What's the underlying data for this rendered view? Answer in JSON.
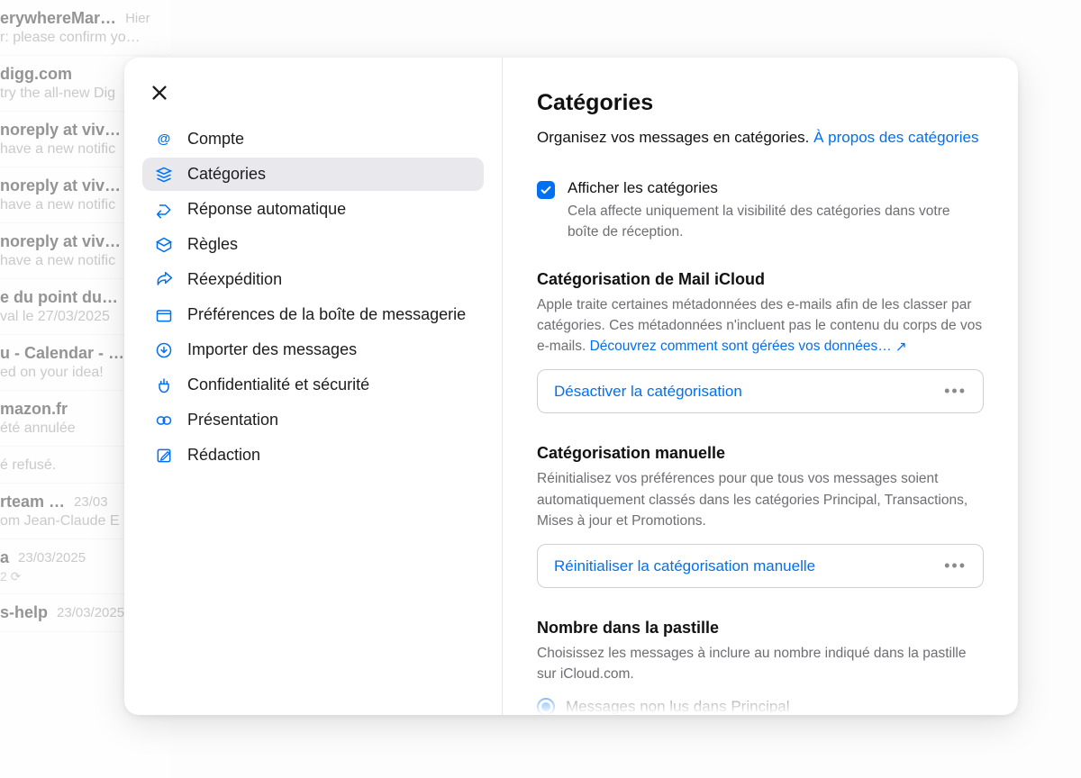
{
  "background_emails": [
    {
      "sender": "erywhereMar…",
      "date": "Hier",
      "preview": "r: please confirm yo…",
      "dot": true
    },
    {
      "sender": "digg.com",
      "date": "",
      "preview": "try the all-new Dig"
    },
    {
      "sender": "noreply at viv…",
      "date": "",
      "preview": "have a new notific"
    },
    {
      "sender": "noreply at viv…",
      "date": "",
      "preview": "have a new notific"
    },
    {
      "sender": "noreply at viv…",
      "date": "",
      "preview": "have a new notific"
    },
    {
      "sender": "e du point du…",
      "date": "",
      "preview": "val le 27/03/2025"
    },
    {
      "sender": "u - Calendar - …",
      "date": "",
      "preview": "ed on your idea!"
    },
    {
      "sender": "mazon.fr",
      "date": "",
      "preview": "été annulée"
    },
    {
      "sender": "",
      "date": "",
      "preview": "é refusé."
    },
    {
      "sender": "rteam …",
      "date": "23/03",
      "preview": "om Jean-Claude E"
    },
    {
      "sender": "a",
      "date": "23/03/2025",
      "preview": "",
      "meta": "2 ⟳"
    },
    {
      "sender": "s-help",
      "date": "23/03/2025",
      "preview": ""
    }
  ],
  "sidebar": {
    "items": [
      {
        "key": "account",
        "label": "Compte"
      },
      {
        "key": "categories",
        "label": "Catégories",
        "active": true
      },
      {
        "key": "autoreply",
        "label": "Réponse automatique"
      },
      {
        "key": "rules",
        "label": "Règles"
      },
      {
        "key": "forwarding",
        "label": "Réexpédition"
      },
      {
        "key": "mailbox",
        "label": "Préférences de la boîte de messagerie"
      },
      {
        "key": "import",
        "label": "Importer des messages"
      },
      {
        "key": "privacy",
        "label": "Confidentialité et sécurité"
      },
      {
        "key": "appearance",
        "label": "Présentation"
      },
      {
        "key": "composing",
        "label": "Rédaction"
      }
    ]
  },
  "page": {
    "title": "Catégories",
    "subtitle_text": "Organisez vos messages en catégories. ",
    "subtitle_link": "À propos des catégories",
    "show_categories": {
      "label": "Afficher les catégories",
      "desc": "Cela affecte uniquement la visibilité des catégories dans votre boîte de réception.",
      "checked": true
    },
    "icloud_section": {
      "title": "Catégorisation de Mail iCloud",
      "desc_start": "Apple traite certaines métadonnées des e-mails afin de les classer par catégories. Ces métadonnées n'incluent pas le contenu du corps de vos e-mails. ",
      "desc_link": "Découvrez comment sont gérées vos données…",
      "button": "Désactiver la catégorisation"
    },
    "manual_section": {
      "title": "Catégorisation manuelle",
      "desc": "Réinitialisez vos préférences pour que tous vos messages soient automatiquement classés dans les catégories Principal, Transactions, Mises à jour et Promotions.",
      "button": "Réinitialiser la catégorisation manuelle"
    },
    "badge_section": {
      "title": "Nombre dans la pastille",
      "desc": "Choisissez les messages à inclure au nombre indiqué dans la pastille sur iCloud.com.",
      "radio_selected": "Messages non lus dans Principal"
    }
  }
}
